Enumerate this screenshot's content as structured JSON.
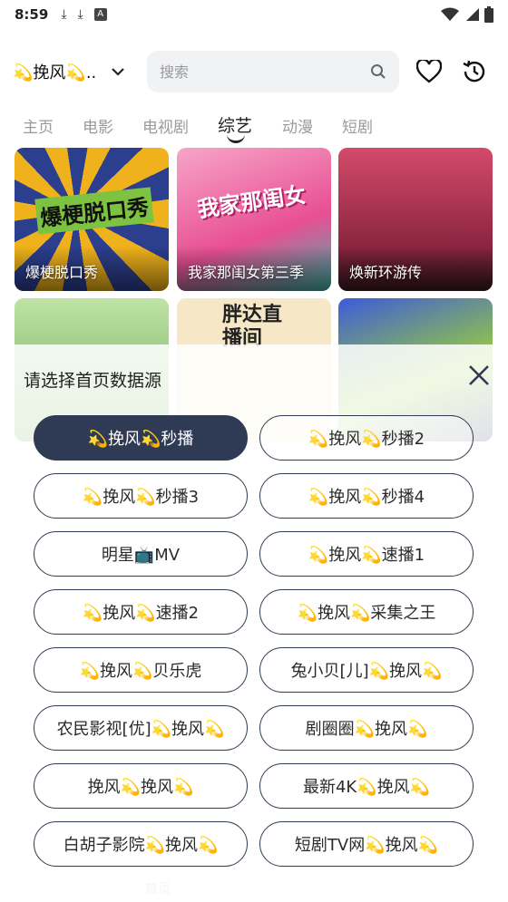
{
  "status_bar": {
    "time": "8:59",
    "icons": [
      "download-icon",
      "download-icon",
      "font-icon"
    ],
    "right_icons": [
      "wifi-icon",
      "signal-icon",
      "battery-icon"
    ]
  },
  "header": {
    "source_label": "💫挽风💫..",
    "search_placeholder": "搜索",
    "icons": [
      "chevron-down-icon",
      "search-icon",
      "heart-icon",
      "history-icon"
    ]
  },
  "tabs": [
    {
      "label": "主页",
      "active": false
    },
    {
      "label": "电影",
      "active": false
    },
    {
      "label": "电视剧",
      "active": false
    },
    {
      "label": "综艺",
      "active": true
    },
    {
      "label": "动漫",
      "active": false
    },
    {
      "label": "短剧",
      "active": false
    }
  ],
  "cards": [
    {
      "title": "爆梗脱口秀",
      "poster_text": "爆梗脱口秀",
      "color": "#f0b21c"
    },
    {
      "title": "我家那闺女第三季",
      "poster_text": "我家那闺女",
      "color": "#e84f93"
    },
    {
      "title": "焕新环游传",
      "poster_text": "",
      "color": "#c7385b"
    },
    {
      "title": "",
      "poster_text": "",
      "color": "#6aa84f"
    },
    {
      "title": "",
      "poster_text": "胖达直播间",
      "color": "#f6e7c6"
    },
    {
      "title": "",
      "poster_text": "",
      "color": "#3d5bd9"
    }
  ],
  "bottom_nav": {
    "home_label": "首页"
  },
  "source_sheet": {
    "title": "请选择首页数据源",
    "options": [
      {
        "label": "💫挽风💫秒播",
        "selected": true
      },
      {
        "label": "💫挽风💫秒播2",
        "selected": false
      },
      {
        "label": "💫挽风💫秒播3",
        "selected": false
      },
      {
        "label": "💫挽风💫秒播4",
        "selected": false
      },
      {
        "label": "明星📺MV",
        "selected": false
      },
      {
        "label": "💫挽风💫速播1",
        "selected": false
      },
      {
        "label": "💫挽风💫速播2",
        "selected": false
      },
      {
        "label": "💫挽风💫采集之王",
        "selected": false
      },
      {
        "label": "💫挽风💫贝乐虎",
        "selected": false
      },
      {
        "label": "兔小贝[儿]💫挽风💫",
        "selected": false
      },
      {
        "label": "农民影视[优]💫挽风💫",
        "selected": false
      },
      {
        "label": "剧圈圈💫挽风💫",
        "selected": false
      },
      {
        "label": "挽风💫挽风💫",
        "selected": false
      },
      {
        "label": "最新4K💫挽风💫",
        "selected": false
      },
      {
        "label": "白胡子影院💫挽风💫",
        "selected": false
      },
      {
        "label": "短剧TV网💫挽风💫",
        "selected": false
      }
    ]
  },
  "colors": {
    "accent": "#2f3b55",
    "tab_inactive": "#9a9a9a"
  }
}
